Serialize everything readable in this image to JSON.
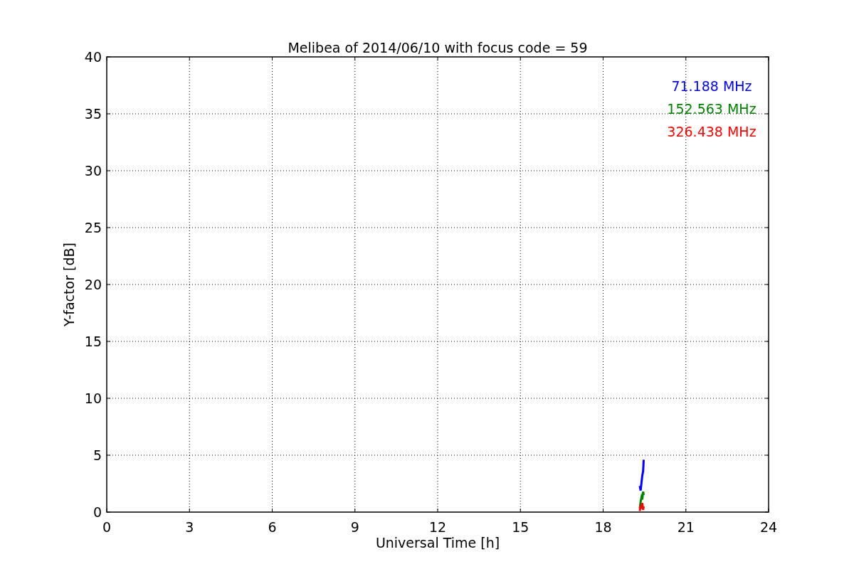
{
  "chart_data": {
    "type": "line",
    "title": "Melibea of 2014/06/10 with focus code = 59",
    "xlabel": "Universal Time [h]",
    "ylabel": "Y-factor [dB]",
    "grid": true,
    "xlim": [
      0,
      24
    ],
    "ylim": [
      0,
      40
    ],
    "xticks": [
      0,
      3,
      6,
      9,
      12,
      15,
      18,
      21,
      24
    ],
    "yticks": [
      0,
      5,
      10,
      15,
      20,
      25,
      30,
      35,
      40
    ],
    "x": [
      19.33,
      19.36,
      19.39,
      19.42,
      19.45,
      19.47
    ],
    "series": [
      {
        "name": "71.188 MHz",
        "color": "#0000ff",
        "values": [
          2.3,
          1.9,
          2.6,
          3.2,
          3.6,
          4.6
        ]
      },
      {
        "name": "152.563 MHz",
        "color": "#008000",
        "values": [
          0.3,
          0.9,
          1.3,
          1.1,
          1.8,
          1.5
        ]
      },
      {
        "name": "326.438 MHz",
        "color": "#ff0000",
        "values": [
          0.1,
          0.6,
          0.3,
          0.8,
          0.2,
          0.5
        ]
      }
    ]
  }
}
